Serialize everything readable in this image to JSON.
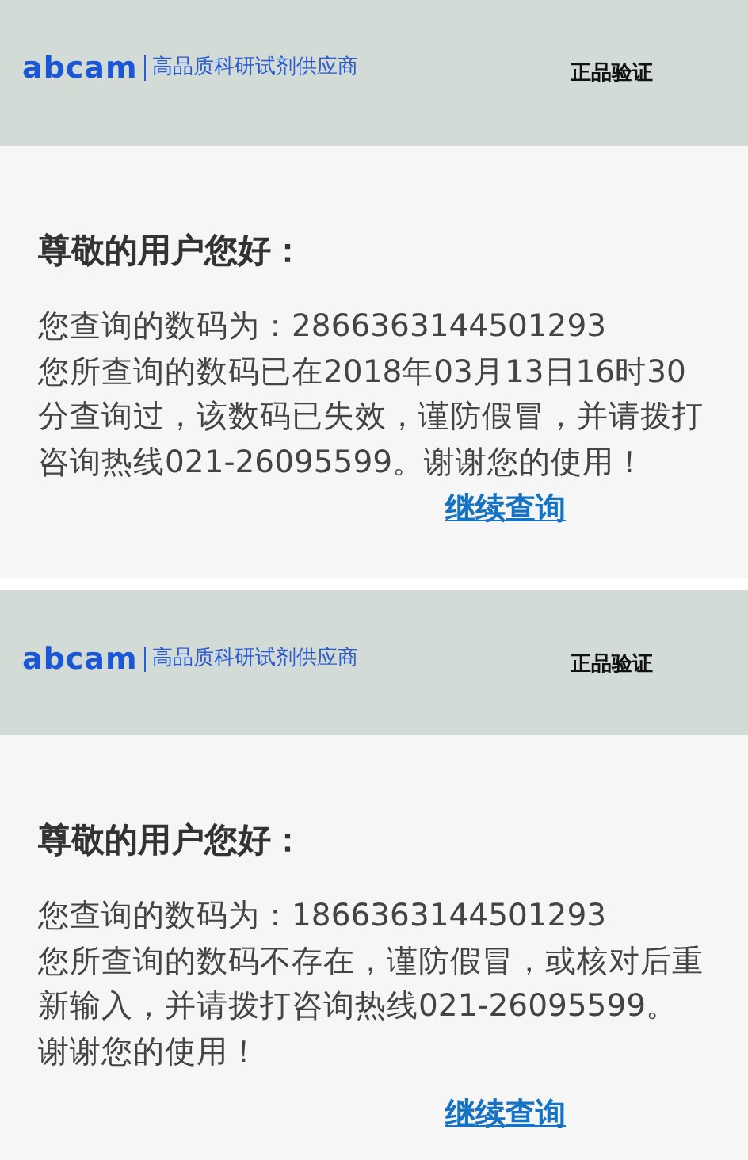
{
  "panels": [
    {
      "header": {
        "logo": "abcam",
        "tagline": "高品质科研试剂供应商",
        "verify": "正品验证"
      },
      "greeting": "尊敬的用户您好：",
      "code_line": "您查询的数码为：2866363144501293",
      "message": "您所查询的数码已在2018年03月13日16时30分查询过，该数码已失效，谨防假冒，并请拨打咨询热线021-26095599。谢谢您的使用！",
      "link": "继续查询"
    },
    {
      "header": {
        "logo": "abcam",
        "tagline": "高品质科研试剂供应商",
        "verify": "正品验证"
      },
      "greeting": "尊敬的用户您好：",
      "code_line": "您查询的数码为：1866363144501293",
      "message": "您所查询的数码不存在，谨防假冒，或核对后重新输入，并请拨打咨询热线021-26095599。谢谢您的使用！",
      "link": "继续查询"
    }
  ]
}
